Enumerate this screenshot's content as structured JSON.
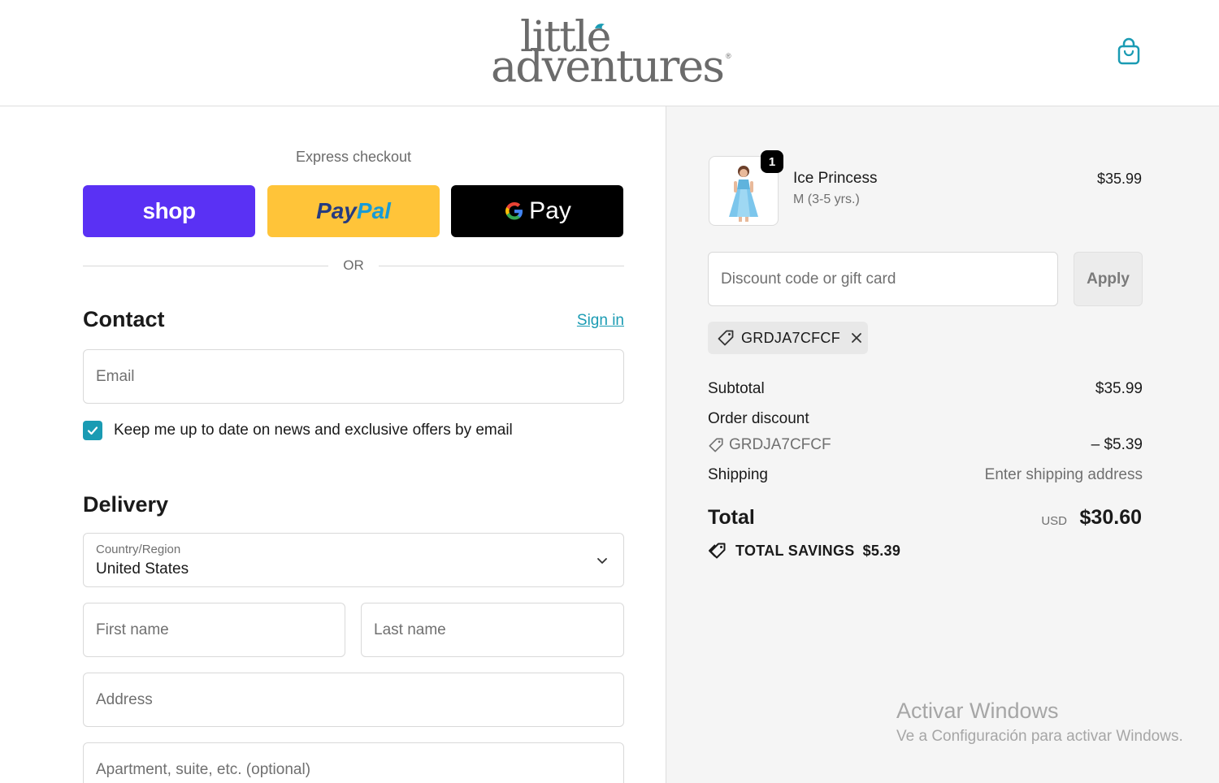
{
  "header": {
    "logo_line1": "little",
    "logo_line2": "adventures",
    "logo_reg": "®",
    "cart_icon": "shopping-bag-icon"
  },
  "express": {
    "label": "Express checkout",
    "shop_label": "shop",
    "paypal_label_1": "Pay",
    "paypal_label_2": "Pal",
    "gpay_label": "Pay",
    "or_label": "OR"
  },
  "contact": {
    "title": "Contact",
    "signin_label": "Sign in",
    "email_placeholder": "Email",
    "newsletter_checked": true,
    "newsletter_label": "Keep me up to date on news and exclusive offers by email"
  },
  "delivery": {
    "title": "Delivery",
    "country_label": "Country/Region",
    "country_value": "United States",
    "first_name_placeholder": "First name",
    "last_name_placeholder": "Last name",
    "address_placeholder": "Address",
    "apartment_placeholder": "Apartment, suite, etc. (optional)"
  },
  "order": {
    "item": {
      "quantity": "1",
      "name": "Ice Princess",
      "variant": "M (3-5 yrs.)",
      "price": "$35.99"
    },
    "discount_placeholder": "Discount code or gift card",
    "apply_label": "Apply",
    "applied_code": "GRDJA7CFCF",
    "subtotal_label": "Subtotal",
    "subtotal_value": "$35.99",
    "order_discount_label": "Order discount",
    "discount_code": "GRDJA7CFCF",
    "discount_value": "– $5.39",
    "shipping_label": "Shipping",
    "shipping_value": "Enter shipping address",
    "total_label": "Total",
    "total_currency": "USD",
    "total_value": "$30.60",
    "savings_label": "TOTAL SAVINGS",
    "savings_value": "$5.39"
  },
  "watermark": {
    "line1": "Activar Windows",
    "line2": "Ve a Configuración para activar Windows."
  },
  "colors": {
    "accent": "#1a9bb3",
    "shop_pay": "#5a31f4",
    "paypal": "#ffc439",
    "gpay": "#000000"
  }
}
